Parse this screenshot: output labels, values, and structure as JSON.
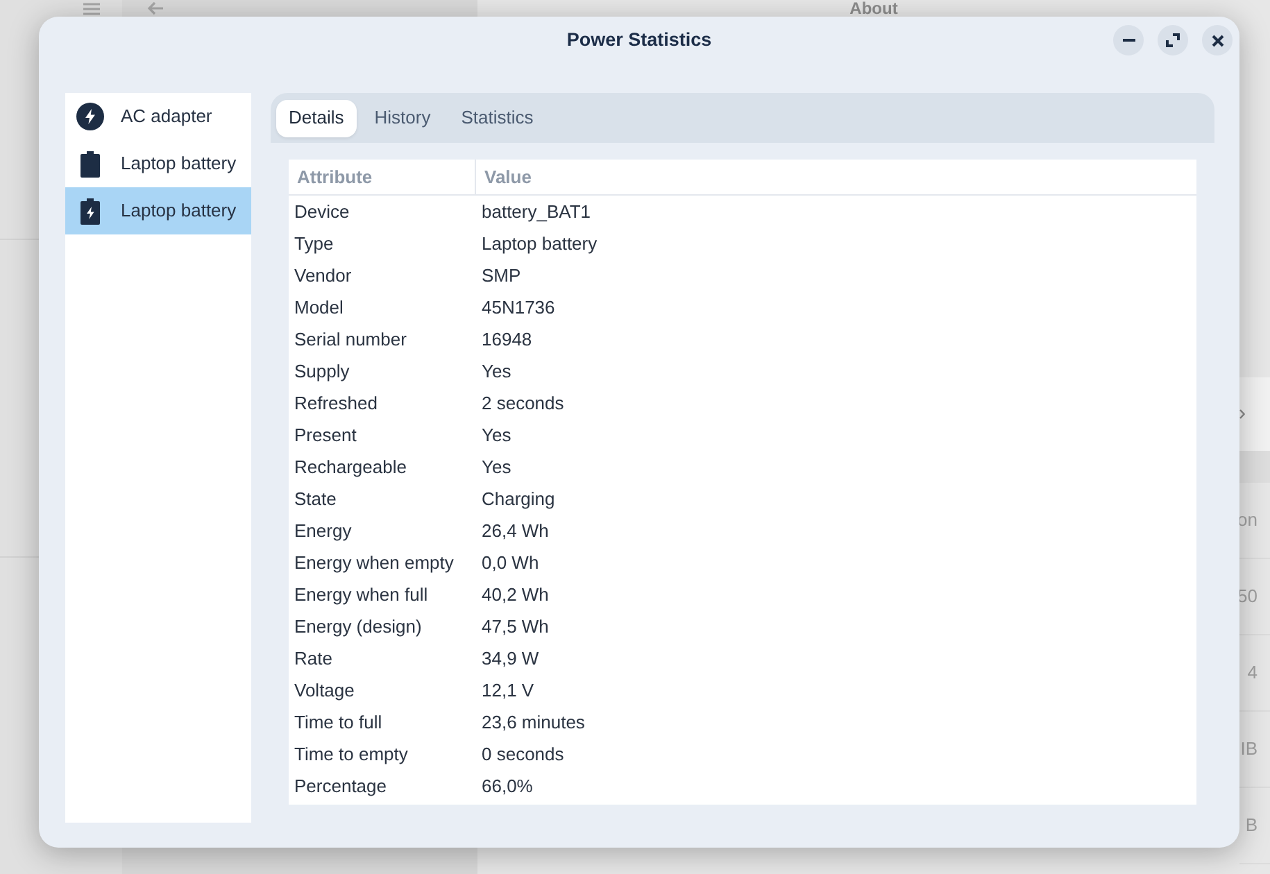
{
  "background_window": {
    "title": "About",
    "cells": [
      "on",
      "50",
      "4",
      "IB",
      "B"
    ]
  },
  "window": {
    "title": "Power Statistics"
  },
  "devices": [
    {
      "label": "AC adapter",
      "kind": "ac",
      "selected": false
    },
    {
      "label": "Laptop battery",
      "kind": "battery",
      "selected": false
    },
    {
      "label": "Laptop battery",
      "kind": "battery-charging",
      "selected": true
    }
  ],
  "tabs": [
    {
      "label": "Details",
      "selected": true
    },
    {
      "label": "History",
      "selected": false
    },
    {
      "label": "Statistics",
      "selected": false
    }
  ],
  "table": {
    "columns": [
      "Attribute",
      "Value"
    ],
    "rows": [
      [
        "Device",
        "battery_BAT1"
      ],
      [
        "Type",
        "Laptop battery"
      ],
      [
        "Vendor",
        "SMP"
      ],
      [
        "Model",
        "45N1736"
      ],
      [
        "Serial number",
        "16948"
      ],
      [
        "Supply",
        "Yes"
      ],
      [
        "Refreshed",
        "2 seconds"
      ],
      [
        "Present",
        "Yes"
      ],
      [
        "Rechargeable",
        "Yes"
      ],
      [
        "State",
        "Charging"
      ],
      [
        "Energy",
        "26,4 Wh"
      ],
      [
        "Energy when empty",
        "0,0 Wh"
      ],
      [
        "Energy when full",
        "40,2 Wh"
      ],
      [
        "Energy (design)",
        "47,5 Wh"
      ],
      [
        "Rate",
        "34,9 W"
      ],
      [
        "Voltage",
        "12,1 V"
      ],
      [
        "Time to full",
        "23,6 minutes"
      ],
      [
        "Time to empty",
        "0 seconds"
      ],
      [
        "Percentage",
        "66,0%"
      ]
    ]
  }
}
